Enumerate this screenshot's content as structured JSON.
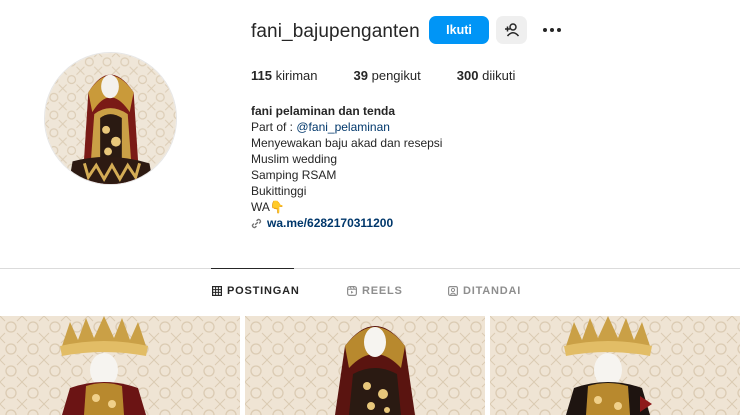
{
  "profile": {
    "username": "fani_bajupenganten",
    "follow_label": "Ikuti",
    "suggest_icon": "person-add-icon",
    "more_icon": "more-options-icon",
    "avatar_icon": "profile-avatar"
  },
  "stats": {
    "posts_count": "115",
    "posts_label": "kiriman",
    "followers_count": "39",
    "followers_label": "pengikut",
    "following_count": "300",
    "following_label": "diikuti"
  },
  "bio": {
    "name": "fani pelaminan dan tenda",
    "part_of_prefix": "Part of :",
    "part_of_tag": "@fani_pelaminan",
    "lines": [
      "Menyewakan baju akad dan resepsi",
      "Muslim wedding",
      "Samping RSAM",
      "Bukittinggi",
      "WA👇"
    ],
    "link": "wa.me/6282170311200"
  },
  "tabs": [
    {
      "label": "POSTINGAN",
      "icon": "grid-icon",
      "active": true
    },
    {
      "label": "REELS",
      "icon": "reels-icon",
      "active": false
    },
    {
      "label": "DITANDAI",
      "icon": "tagged-icon",
      "active": false
    }
  ],
  "colors": {
    "accent": "#0095f6",
    "link": "#00376b",
    "text": "#262626",
    "muted": "#8e8e8e"
  }
}
